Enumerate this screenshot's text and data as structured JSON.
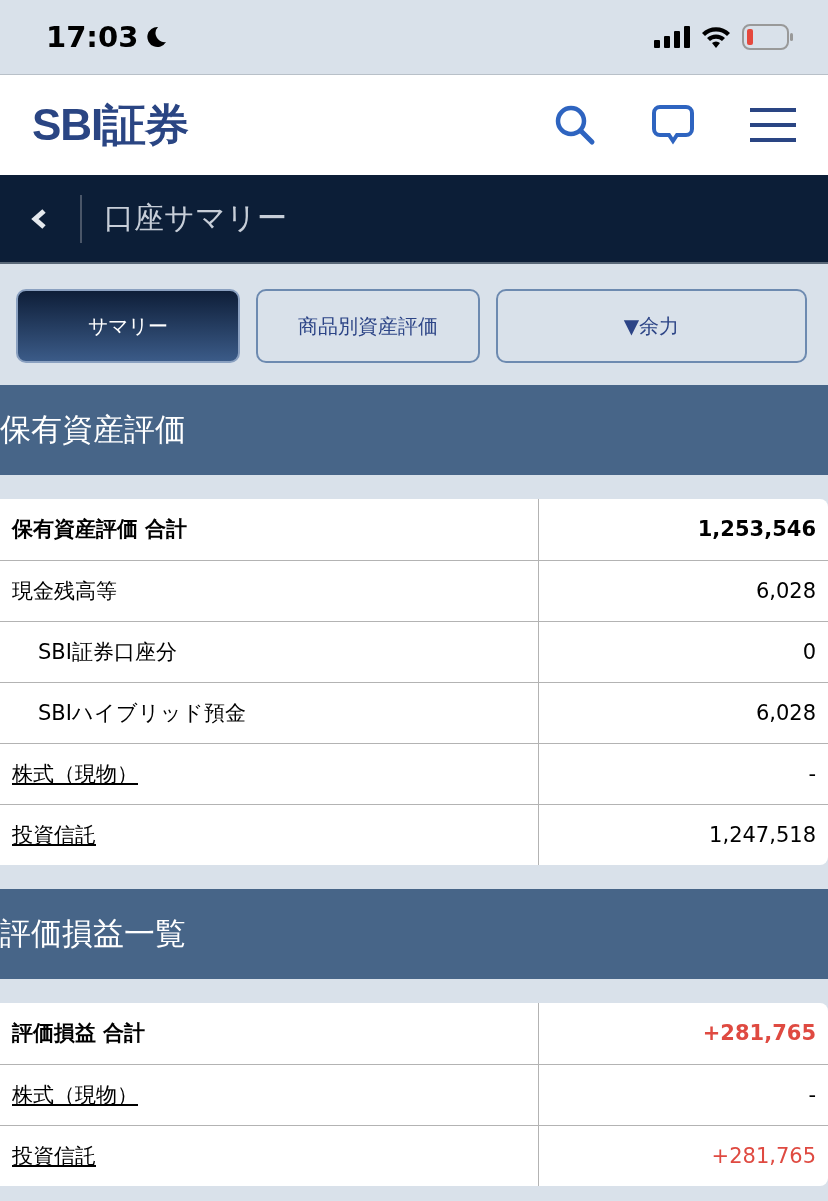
{
  "status_bar": {
    "time": "17:03"
  },
  "header": {
    "logo": "SBI証券"
  },
  "nav": {
    "title": "口座サマリー"
  },
  "tabs": [
    {
      "label": "サマリー",
      "selected": true
    },
    {
      "label": "商品別資産評価",
      "selected": false
    },
    {
      "label": "▼余力",
      "selected": false
    }
  ],
  "sections": [
    {
      "title": "保有資産評価",
      "rows": [
        {
          "kind": "total",
          "label": "保有資産評価 合計",
          "value": "1,253,546",
          "color": "#000000"
        },
        {
          "kind": "plain",
          "label": "現金残高等",
          "value": "6,028",
          "color": "#000000"
        },
        {
          "kind": "sub",
          "label": "SBI証券口座分",
          "value": "0",
          "color": "#000000"
        },
        {
          "kind": "sub",
          "label": "SBIハイブリッド預金",
          "value": "6,028",
          "color": "#000000"
        },
        {
          "kind": "link",
          "label": "株式（現物）",
          "value": "-",
          "color": "#000000"
        },
        {
          "kind": "link",
          "label": "投資信託",
          "value": "1,247,518",
          "color": "#000000"
        }
      ]
    },
    {
      "title": "評価損益一覧",
      "rows": [
        {
          "kind": "total",
          "label": "評価損益 合計",
          "value": "+281,765",
          "color": "#df4a41"
        },
        {
          "kind": "link",
          "label": "株式（現物）",
          "value": "-",
          "color": "#000000"
        },
        {
          "kind": "link",
          "label": "投資信託",
          "value": "+281,765",
          "color": "#df4a41"
        }
      ]
    }
  ]
}
